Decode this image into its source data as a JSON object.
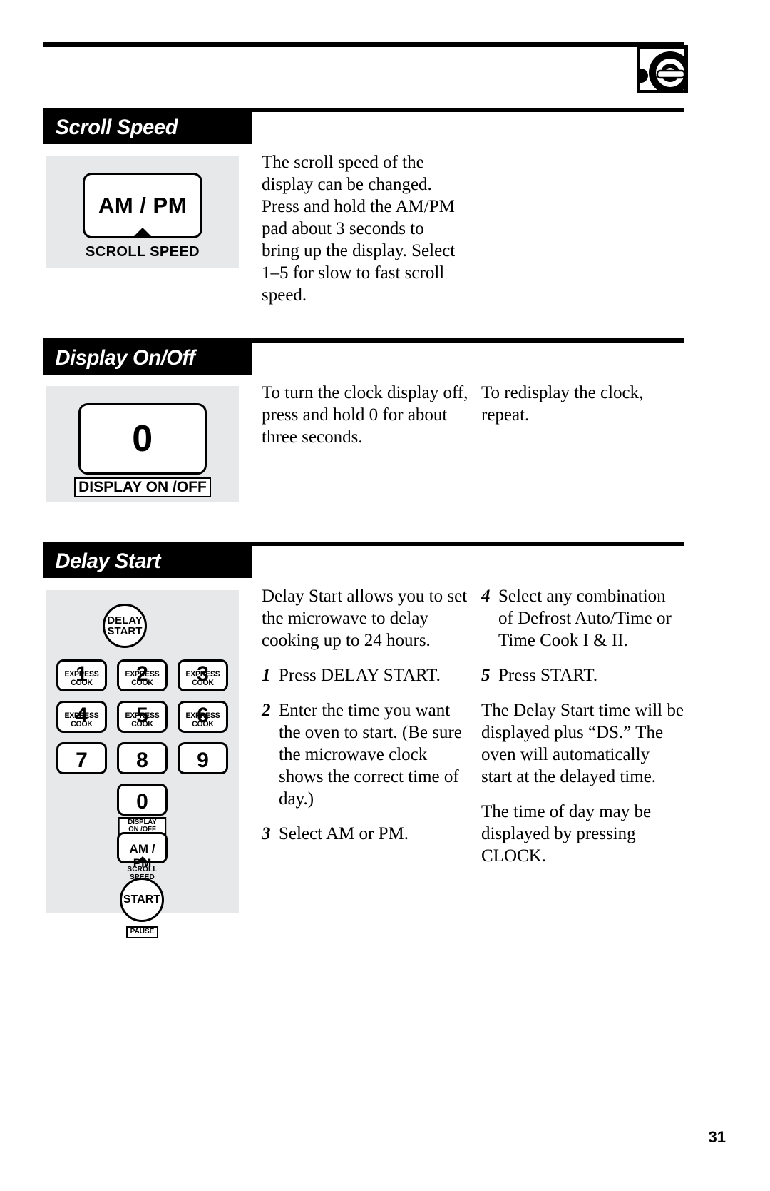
{
  "document": {
    "page_number": "31",
    "brand_logo": "ge-logo"
  },
  "sections": [
    {
      "id": "scroll-speed",
      "title": "Scroll Speed",
      "illustration": {
        "key_label": "AM / PM",
        "key_sublabel": "SCROLL SPEED"
      },
      "columns": [
        {
          "paragraphs": [
            "The scroll speed of the display can be changed. Press and hold the AM/PM pad about 3 seconds to bring up the display. Select 1–5 for slow to fast scroll speed."
          ]
        }
      ]
    },
    {
      "id": "display-on-off",
      "title": "Display On/Off",
      "illustration": {
        "key_label": "0",
        "key_sublabel": "DISPLAY ON /OFF"
      },
      "columns": [
        {
          "paragraphs": [
            "To turn the clock display off, press and hold 0 for about three seconds."
          ]
        },
        {
          "paragraphs": [
            "To redisplay the clock, repeat."
          ]
        }
      ]
    },
    {
      "id": "delay-start",
      "title": "Delay Start",
      "columns": [
        {
          "intro": "Delay Start allows you to set the microwave to delay cooking up to 24 hours.",
          "steps": [
            {
              "num": "1",
              "text": "Press DELAY START."
            },
            {
              "num": "2",
              "text": "Enter the time you want the oven to start. (Be sure the microwave clock shows the correct time of day.)"
            },
            {
              "num": "3",
              "text": "Select AM or PM."
            }
          ]
        },
        {
          "steps": [
            {
              "num": "4",
              "text": "Select any combination of Defrost Auto/Time or Time Cook I & II."
            },
            {
              "num": "5",
              "text": "Press START."
            }
          ],
          "paragraphs": [
            "The Delay Start time will be displayed plus “DS.” The oven will automatically start at the delayed time.",
            "The time of day may be displayed by pressing CLOCK."
          ]
        }
      ]
    }
  ],
  "keypad": {
    "delay_start": {
      "line1": "DELAY",
      "line2": "START"
    },
    "keys": [
      {
        "digit": "1",
        "sub": "EXPRESS COOK"
      },
      {
        "digit": "2",
        "sub": "EXPRESS COOK"
      },
      {
        "digit": "3",
        "sub": "EXPRESS COOK"
      },
      {
        "digit": "4",
        "sub": "EXPRESS COOK"
      },
      {
        "digit": "5",
        "sub": "EXPRESS COOK"
      },
      {
        "digit": "6",
        "sub": "EXPRESS COOK"
      },
      {
        "digit": "7",
        "sub": ""
      },
      {
        "digit": "8",
        "sub": ""
      },
      {
        "digit": "9",
        "sub": ""
      }
    ],
    "zero_key": {
      "digit": "0",
      "sub": "DISPLAY ON /OFF"
    },
    "ampm_key": {
      "label": "AM / PM",
      "sub": "SCROLL SPEED"
    },
    "start_key": {
      "label": "START",
      "sub": "PAUSE"
    }
  },
  "colors": {
    "panel_grey": "#e6e8e9",
    "bar_black": "#000000",
    "page_white": "#ffffff"
  }
}
